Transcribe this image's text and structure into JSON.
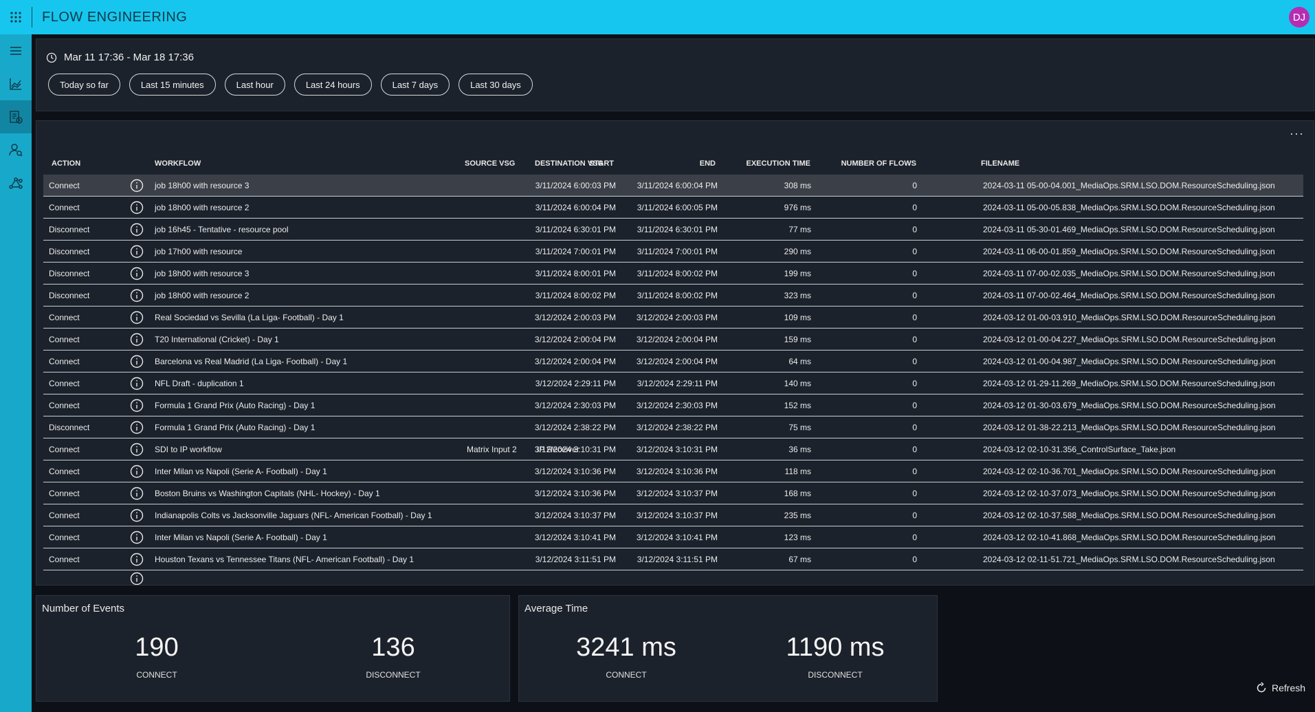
{
  "app": {
    "title": "FLOW ENGINEERING",
    "user_initials": "DJ"
  },
  "sidebar": {
    "items": [
      {
        "name": "menu",
        "icon": "hamburger-icon"
      },
      {
        "name": "analytics",
        "icon": "area-chart-icon"
      },
      {
        "name": "report",
        "icon": "document-clock-icon",
        "active": true
      },
      {
        "name": "users",
        "icon": "user-search-icon"
      },
      {
        "name": "flows",
        "icon": "network-graph-icon"
      }
    ]
  },
  "time_filter": {
    "range": "Mar 11 17:36 - Mar 18 17:36",
    "presets": [
      "Today so far",
      "Last 15 minutes",
      "Last hour",
      "Last 24 hours",
      "Last 7 days",
      "Last 30 days"
    ]
  },
  "table": {
    "headers": {
      "action": "ACTION",
      "workflow": "WORKFLOW",
      "source": "SOURCE VSG",
      "destination": "DESTINATION VSG",
      "start": "START",
      "end": "END",
      "exec": "EXECUTION TIME",
      "flows": "NUMBER OF FLOWS",
      "file": "FILENAME"
    },
    "rows": [
      {
        "action": "Connect",
        "workflow": "job 18h00 with resource 3",
        "source": "",
        "destination": "",
        "start": "3/11/2024 6:00:03 PM",
        "end": "3/11/2024 6:00:04 PM",
        "exec": "308 ms",
        "flows": "0",
        "file": "2024-03-11 05-00-04.001_MediaOps.SRM.LSO.DOM.ResourceScheduling.json"
      },
      {
        "action": "Connect",
        "workflow": "job 18h00 with resource 2",
        "source": "",
        "destination": "",
        "start": "3/11/2024 6:00:04 PM",
        "end": "3/11/2024 6:00:05 PM",
        "exec": "976 ms",
        "flows": "0",
        "file": "2024-03-11 05-00-05.838_MediaOps.SRM.LSO.DOM.ResourceScheduling.json"
      },
      {
        "action": "Disconnect",
        "workflow": "job 16h45 - Tentative - resource pool",
        "source": "",
        "destination": "",
        "start": "3/11/2024 6:30:01 PM",
        "end": "3/11/2024 6:30:01 PM",
        "exec": "77 ms",
        "flows": "0",
        "file": "2024-03-11 05-30-01.469_MediaOps.SRM.LSO.DOM.ResourceScheduling.json"
      },
      {
        "action": "Disconnect",
        "workflow": "job 17h00 with resource",
        "source": "",
        "destination": "",
        "start": "3/11/2024 7:00:01 PM",
        "end": "3/11/2024 7:00:01 PM",
        "exec": "290 ms",
        "flows": "0",
        "file": "2024-03-11 06-00-01.859_MediaOps.SRM.LSO.DOM.ResourceScheduling.json"
      },
      {
        "action": "Disconnect",
        "workflow": "job 18h00 with resource 3",
        "source": "",
        "destination": "",
        "start": "3/11/2024 8:00:01 PM",
        "end": "3/11/2024 8:00:02 PM",
        "exec": "199 ms",
        "flows": "0",
        "file": "2024-03-11 07-00-02.035_MediaOps.SRM.LSO.DOM.ResourceScheduling.json"
      },
      {
        "action": "Disconnect",
        "workflow": "job 18h00 with resource 2",
        "source": "",
        "destination": "",
        "start": "3/11/2024 8:00:02 PM",
        "end": "3/11/2024 8:00:02 PM",
        "exec": "323 ms",
        "flows": "0",
        "file": "2024-03-11 07-00-02.464_MediaOps.SRM.LSO.DOM.ResourceScheduling.json"
      },
      {
        "action": "Connect",
        "workflow": "Real Sociedad vs Sevilla (La Liga- Football) - Day 1",
        "source": "",
        "destination": "",
        "start": "3/12/2024 2:00:03 PM",
        "end": "3/12/2024 2:00:03 PM",
        "exec": "109 ms",
        "flows": "0",
        "file": "2024-03-12 01-00-03.910_MediaOps.SRM.LSO.DOM.ResourceScheduling.json"
      },
      {
        "action": "Connect",
        "workflow": "T20 International (Cricket) - Day 1",
        "source": "",
        "destination": "",
        "start": "3/12/2024 2:00:04 PM",
        "end": "3/12/2024 2:00:04 PM",
        "exec": "159 ms",
        "flows": "0",
        "file": "2024-03-12 01-00-04.227_MediaOps.SRM.LSO.DOM.ResourceScheduling.json"
      },
      {
        "action": "Connect",
        "workflow": "Barcelona vs Real Madrid (La Liga- Football) - Day 1",
        "source": "",
        "destination": "",
        "start": "3/12/2024 2:00:04 PM",
        "end": "3/12/2024 2:00:04 PM",
        "exec": "64 ms",
        "flows": "0",
        "file": "2024-03-12 01-00-04.987_MediaOps.SRM.LSO.DOM.ResourceScheduling.json"
      },
      {
        "action": "Connect",
        "workflow": "NFL Draft - duplication 1",
        "source": "",
        "destination": "",
        "start": "3/12/2024 2:29:11 PM",
        "end": "3/12/2024 2:29:11 PM",
        "exec": "140 ms",
        "flows": "0",
        "file": "2024-03-12 01-29-11.269_MediaOps.SRM.LSO.DOM.ResourceScheduling.json"
      },
      {
        "action": "Connect",
        "workflow": "Formula 1 Grand Prix (Auto Racing) - Day 1",
        "source": "",
        "destination": "",
        "start": "3/12/2024 2:30:03 PM",
        "end": "3/12/2024 2:30:03 PM",
        "exec": "152 ms",
        "flows": "0",
        "file": "2024-03-12 01-30-03.679_MediaOps.SRM.LSO.DOM.ResourceScheduling.json"
      },
      {
        "action": "Disconnect",
        "workflow": "Formula 1 Grand Prix (Auto Racing) - Day 1",
        "source": "",
        "destination": "",
        "start": "3/12/2024 2:38:22 PM",
        "end": "3/12/2024 2:38:22 PM",
        "exec": "75 ms",
        "flows": "0",
        "file": "2024-03-12 01-38-22.213_MediaOps.SRM.LSO.DOM.ResourceScheduling.json"
      },
      {
        "action": "Connect",
        "workflow": "SDI to IP workflow",
        "source": "Matrix Input 2",
        "destination": "IP Receiver",
        "start": "3/12/2024 3:10:31 PM",
        "end": "3/12/2024 3:10:31 PM",
        "exec": "36 ms",
        "flows": "0",
        "file": "2024-03-12 02-10-31.356_ControlSurface_Take.json"
      },
      {
        "action": "Connect",
        "workflow": "Inter Milan vs Napoli (Serie A- Football) - Day 1",
        "source": "",
        "destination": "",
        "start": "3/12/2024 3:10:36 PM",
        "end": "3/12/2024 3:10:36 PM",
        "exec": "118 ms",
        "flows": "0",
        "file": "2024-03-12 02-10-36.701_MediaOps.SRM.LSO.DOM.ResourceScheduling.json"
      },
      {
        "action": "Connect",
        "workflow": "Boston Bruins vs Washington Capitals (NHL- Hockey) - Day 1",
        "source": "",
        "destination": "",
        "start": "3/12/2024 3:10:36 PM",
        "end": "3/12/2024 3:10:37 PM",
        "exec": "168 ms",
        "flows": "0",
        "file": "2024-03-12 02-10-37.073_MediaOps.SRM.LSO.DOM.ResourceScheduling.json"
      },
      {
        "action": "Connect",
        "workflow": "Indianapolis Colts vs Jacksonville Jaguars (NFL- American Football) - Day 1",
        "source": "",
        "destination": "",
        "start": "3/12/2024 3:10:37 PM",
        "end": "3/12/2024 3:10:37 PM",
        "exec": "235 ms",
        "flows": "0",
        "file": "2024-03-12 02-10-37.588_MediaOps.SRM.LSO.DOM.ResourceScheduling.json"
      },
      {
        "action": "Connect",
        "workflow": "Inter Milan vs Napoli (Serie A- Football) - Day 1",
        "source": "",
        "destination": "",
        "start": "3/12/2024 3:10:41 PM",
        "end": "3/12/2024 3:10:41 PM",
        "exec": "123 ms",
        "flows": "0",
        "file": "2024-03-12 02-10-41.868_MediaOps.SRM.LSO.DOM.ResourceScheduling.json"
      },
      {
        "action": "Connect",
        "workflow": "Houston Texans vs Tennessee Titans (NFL- American Football) - Day 1",
        "source": "",
        "destination": "",
        "start": "3/12/2024 3:11:51 PM",
        "end": "3/12/2024 3:11:51 PM",
        "exec": "67 ms",
        "flows": "0",
        "file": "2024-03-12 02-11-51.721_MediaOps.SRM.LSO.DOM.ResourceScheduling.json"
      }
    ]
  },
  "stats": {
    "events": {
      "title": "Number of Events",
      "connect_value": "190",
      "connect_label": "CONNECT",
      "disconnect_value": "136",
      "disconnect_label": "DISCONNECT"
    },
    "average": {
      "title": "Average Time",
      "connect_value": "3241 ms",
      "connect_label": "CONNECT",
      "disconnect_value": "1190 ms",
      "disconnect_label": "DISCONNECT"
    }
  },
  "refresh_label": "Refresh",
  "colors": {
    "topbar": "#17c6ee",
    "sidebar": "#18a9ca",
    "avatar": "#b62db3",
    "background": "#0d1117",
    "panel": "#1c222b"
  }
}
